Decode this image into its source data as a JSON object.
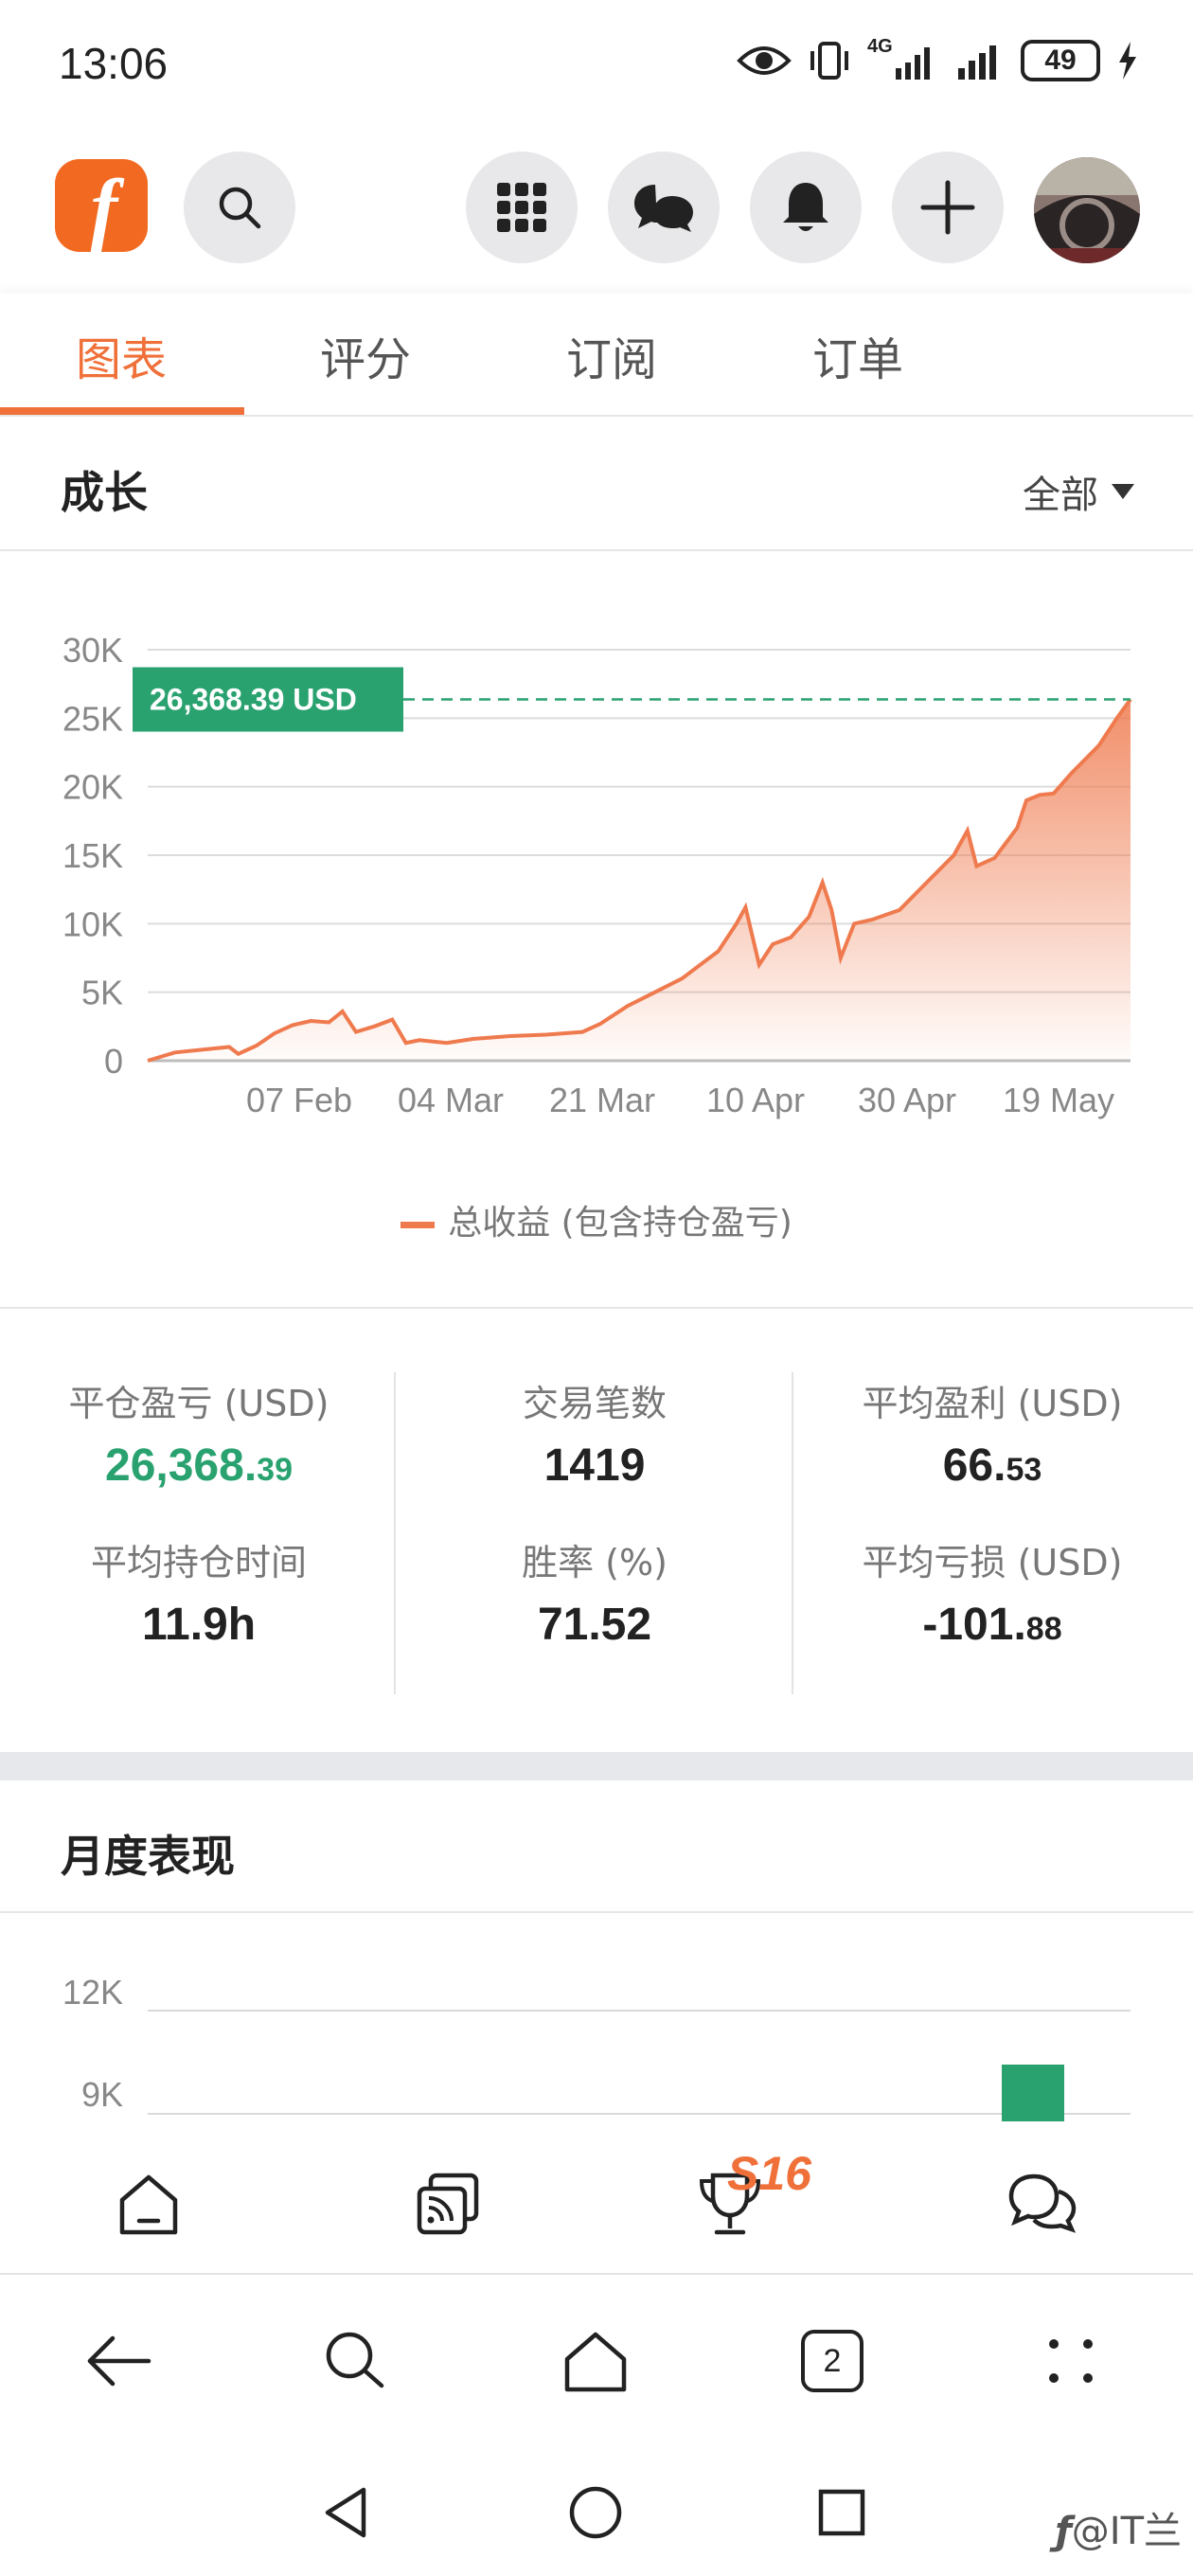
{
  "status_bar": {
    "time": "13:06",
    "network": "4G",
    "battery": "49"
  },
  "header": {
    "logo_letter": "f",
    "icons": [
      "search-icon",
      "apps-grid-icon",
      "chat-bubbles-icon",
      "bell-icon",
      "plus-icon"
    ],
    "avatar": "avatar"
  },
  "tabs": [
    {
      "label": "图表",
      "active": true
    },
    {
      "label": "评分",
      "active": false
    },
    {
      "label": "订阅",
      "active": false
    },
    {
      "label": "订单",
      "active": false
    }
  ],
  "growth": {
    "title": "成长",
    "filter": "全部"
  },
  "chart_data": {
    "type": "area",
    "title": "",
    "xlabel": "",
    "ylabel": "",
    "ylim": [
      0,
      30000
    ],
    "y_ticks": [
      "30K",
      "25K",
      "20K",
      "15K",
      "10K",
      "5K",
      "0"
    ],
    "x_ticks": [
      "07 Feb",
      "04 Mar",
      "21 Mar",
      "10 Apr",
      "30 Apr",
      "19 May"
    ],
    "current_value_label": "26,368.39 USD",
    "current_value": 26368.39,
    "legend": "总收益 (包含持仓盈亏)",
    "series_color": "#ef7a4e",
    "points": [
      [
        0,
        0
      ],
      [
        0.03,
        600
      ],
      [
        0.06,
        800
      ],
      [
        0.09,
        1000
      ],
      [
        0.1,
        500
      ],
      [
        0.12,
        1100
      ],
      [
        0.14,
        2000
      ],
      [
        0.16,
        2600
      ],
      [
        0.18,
        2900
      ],
      [
        0.2,
        2800
      ],
      [
        0.215,
        3600
      ],
      [
        0.23,
        2100
      ],
      [
        0.25,
        2500
      ],
      [
        0.27,
        3000
      ],
      [
        0.285,
        1300
      ],
      [
        0.3,
        1500
      ],
      [
        0.33,
        1300
      ],
      [
        0.36,
        1600
      ],
      [
        0.4,
        1800
      ],
      [
        0.44,
        1900
      ],
      [
        0.48,
        2100
      ],
      [
        0.5,
        2700
      ],
      [
        0.53,
        4000
      ],
      [
        0.56,
        5000
      ],
      [
        0.59,
        6000
      ],
      [
        0.61,
        7000
      ],
      [
        0.63,
        8000
      ],
      [
        0.65,
        10000
      ],
      [
        0.66,
        11200
      ],
      [
        0.675,
        7000
      ],
      [
        0.69,
        8500
      ],
      [
        0.71,
        9000
      ],
      [
        0.73,
        10500
      ],
      [
        0.745,
        13000
      ],
      [
        0.755,
        11000
      ],
      [
        0.765,
        7500
      ],
      [
        0.78,
        10000
      ],
      [
        0.8,
        10300
      ],
      [
        0.83,
        11000
      ],
      [
        0.86,
        13000
      ],
      [
        0.89,
        15000
      ],
      [
        0.905,
        16800
      ],
      [
        0.915,
        14200
      ],
      [
        0.935,
        14800
      ],
      [
        0.96,
        17000
      ],
      [
        0.97,
        19000
      ],
      [
        0.985,
        19400
      ],
      [
        1.0,
        19500
      ],
      [
        1.02,
        21000
      ],
      [
        1.05,
        23000
      ],
      [
        1.07,
        25000
      ],
      [
        1.085,
        26368.39
      ]
    ]
  },
  "stats": [
    {
      "label": "平仓盈亏 (USD)",
      "value_main": "26,368.",
      "value_small": "39",
      "color": "green"
    },
    {
      "label": "交易笔数",
      "value_main": "1419",
      "value_small": ""
    },
    {
      "label": "平均盈利 (USD)",
      "value_main": "66.",
      "value_small": "53"
    },
    {
      "label": "平均持仓时间",
      "value_main": "11.9h",
      "value_small": ""
    },
    {
      "label": "胜率 (%)",
      "value_main": "71.52",
      "value_small": ""
    },
    {
      "label": "平均亏损 (USD)",
      "value_main": "-101.",
      "value_small": "88"
    }
  ],
  "monthly": {
    "title": "月度表现",
    "y_ticks": [
      "12K",
      "9K"
    ],
    "bar_color": "#2aa270"
  },
  "app_nav": {
    "items": [
      "home-icon",
      "feed-icon",
      "trophy-icon",
      "chat-icon"
    ],
    "badge": "S16"
  },
  "browser_bar": {
    "tab_count": "2"
  },
  "watermark": "@IT兰"
}
